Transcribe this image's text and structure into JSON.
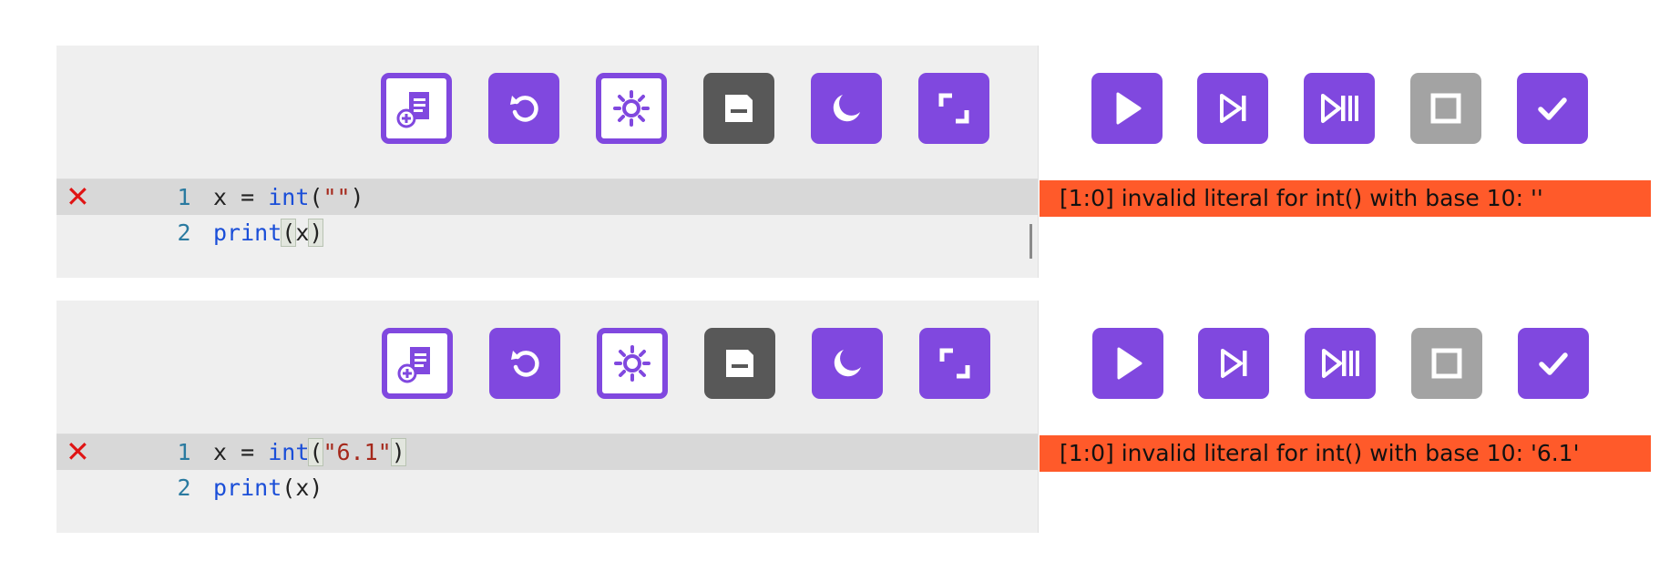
{
  "panels": [
    {
      "editor_toolbar": {
        "new_file_icon": "document-plus-icon",
        "reset_icon": "rotate-left-icon",
        "theme_icon": "sun-icon",
        "save_icon": "floppy-disk-icon",
        "dark_mode_icon": "moon-icon",
        "fullscreen_icon": "expand-icon"
      },
      "runner_toolbar": {
        "run_icon": "play-icon",
        "step_icon": "step-forward-icon",
        "step_pause_icon": "step-pause-icon",
        "stop_icon": "stop-square-icon",
        "check_icon": "checkmark-icon"
      },
      "code": {
        "error_marker": "✕",
        "lines": [
          {
            "number": "1",
            "var": "x",
            "op": " = ",
            "func": "int",
            "open": "(",
            "arg": "\"\"",
            "close": ")"
          },
          {
            "number": "2",
            "func": "print",
            "open": "(",
            "arg": "x",
            "close": ")"
          }
        ]
      },
      "error_message": "[1:0] invalid literal for int() with base 10: ''"
    },
    {
      "editor_toolbar": {
        "new_file_icon": "document-plus-icon",
        "reset_icon": "rotate-left-icon",
        "theme_icon": "sun-icon",
        "save_icon": "floppy-disk-icon",
        "dark_mode_icon": "moon-icon",
        "fullscreen_icon": "expand-icon"
      },
      "runner_toolbar": {
        "run_icon": "play-icon",
        "step_icon": "step-forward-icon",
        "step_pause_icon": "step-pause-icon",
        "stop_icon": "stop-square-icon",
        "check_icon": "checkmark-icon"
      },
      "code": {
        "error_marker": "✕",
        "lines": [
          {
            "number": "1",
            "var": "x",
            "op": " = ",
            "func": "int",
            "open": "(",
            "arg": "\"6.1\"",
            "close": ")"
          },
          {
            "number": "2",
            "func": "print",
            "open": "(",
            "arg": "x",
            "close": ")"
          }
        ]
      },
      "error_message": "[1:0] invalid literal for int() with base 10: '6.1'"
    }
  ],
  "colors": {
    "accent": "#8048df",
    "save_button": "#585858",
    "stop_button": "#a3a3a3",
    "error_background": "#ff5a2a",
    "error_marker": "#e01414"
  }
}
